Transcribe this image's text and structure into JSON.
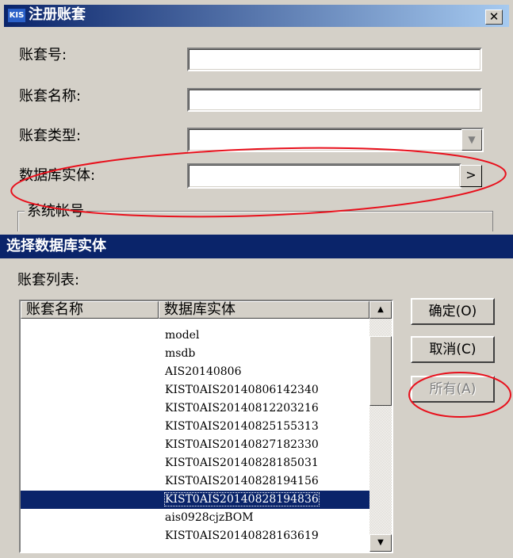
{
  "register_dialog": {
    "title": "注册账套",
    "logo_text": "KIS",
    "close_glyph": "✕",
    "labels": {
      "account_no": "账套号:",
      "account_name": "账套名称:",
      "account_type": "账套类型:",
      "db_entity": "数据库实体:",
      "system_account": "系统帐号"
    },
    "values": {
      "account_no": "",
      "account_name": "",
      "account_type": "",
      "db_entity": ""
    },
    "browse_glyph": ">",
    "combo_arrow_glyph": "▼"
  },
  "select_dialog": {
    "title": "选择数据库实体",
    "list_label": "账套列表:",
    "columns": [
      "账套名称",
      "数据库实体"
    ],
    "rows": [
      {
        "name": "",
        "entity": "model"
      },
      {
        "name": "",
        "entity": "msdb"
      },
      {
        "name": "",
        "entity": "AIS20140806"
      },
      {
        "name": "",
        "entity": "KIST0AIS20140806142340"
      },
      {
        "name": "",
        "entity": "KIST0AIS20140812203216"
      },
      {
        "name": "",
        "entity": "KIST0AIS20140825155313"
      },
      {
        "name": "",
        "entity": "KIST0AIS20140827182330"
      },
      {
        "name": "",
        "entity": "KIST0AIS20140828185031"
      },
      {
        "name": "",
        "entity": "KIST0AIS20140828194156"
      },
      {
        "name": "",
        "entity": "KIST0AIS20140828194836"
      },
      {
        "name": "",
        "entity": "ais0928cjzBOM"
      },
      {
        "name": "",
        "entity": "KIST0AIS20140828163619"
      }
    ],
    "selected_index": 9,
    "buttons": {
      "ok": "确定(O)",
      "cancel": "取消(C)",
      "all": "所有(A)"
    },
    "scroll_up_glyph": "▲",
    "scroll_down_glyph": "▼"
  },
  "colors": {
    "titlebar": "#0a246a",
    "annotation": "#e8101c"
  }
}
